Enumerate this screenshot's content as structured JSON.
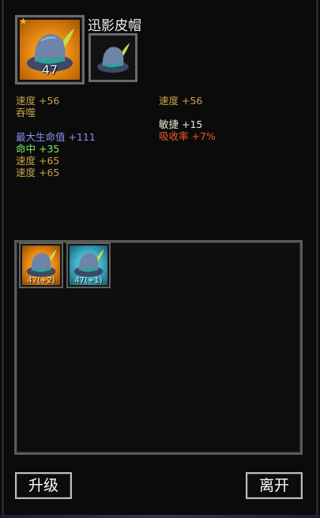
{
  "item": {
    "name": "迅影皮帽",
    "level": "47",
    "star_icon": "star-icon",
    "rarity_color": "#e98a12"
  },
  "stats_left": {
    "base": "速度 +56",
    "devour_label": "吞噬",
    "extra": [
      {
        "label": "最大生命值",
        "value": "+111",
        "color": "#8a8ff0"
      },
      {
        "label": "命中",
        "value": "+35",
        "color": "#7cf06a"
      },
      {
        "label": "速度",
        "value": "+65",
        "color": "#c8a14a"
      },
      {
        "label": "速度",
        "value": "+65",
        "color": "#c8a14a"
      }
    ]
  },
  "stats_right": {
    "base": "速度 +56",
    "extra": [
      {
        "label": "敏捷",
        "value": "+15",
        "color": "#f0ecd6"
      },
      {
        "label": "吸收率",
        "value": "+7%",
        "color": "#f05a2c"
      }
    ]
  },
  "inventory": [
    {
      "label": "47(+2)",
      "icon": "hat-icon",
      "rarity_color": "#e98a12"
    },
    {
      "label": "47(+1)",
      "icon": "hat-icon",
      "rarity_color": "#3fb0c8"
    }
  ],
  "buttons": {
    "upgrade": "升级",
    "leave": "离开"
  }
}
